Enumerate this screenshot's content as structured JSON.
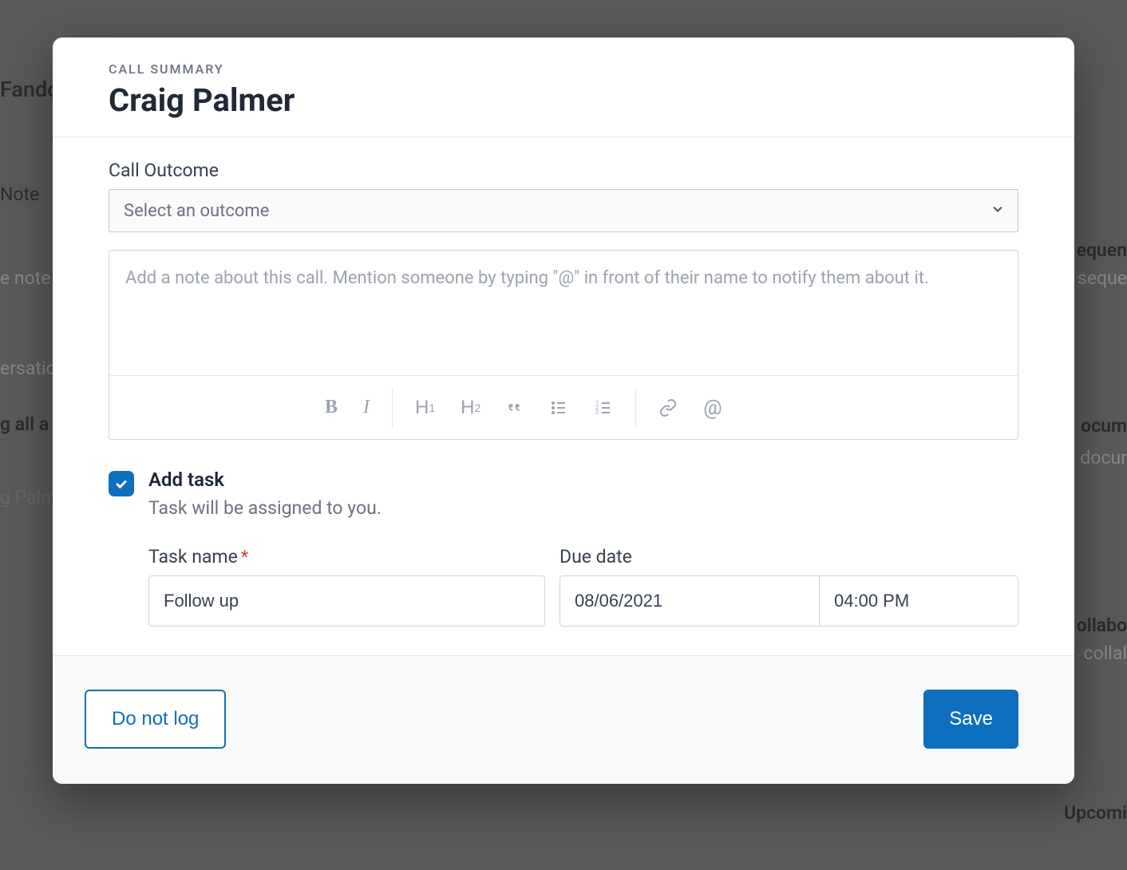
{
  "modal": {
    "eyebrow": "CALL SUMMARY",
    "title": "Craig Palmer",
    "outcome": {
      "label": "Call Outcome",
      "placeholder": "Select an outcome"
    },
    "note": {
      "placeholder": "Add a note about this call. Mention someone by typing \"@\" in front of their name to notify them about it."
    },
    "task": {
      "checkbox_checked": true,
      "title": "Add task",
      "subtitle": "Task will be assigned to you.",
      "name_label": "Task name",
      "name_value": "Follow up",
      "due_label": "Due date",
      "due_date": "08/06/2021",
      "due_time": "04:00 PM"
    },
    "footer": {
      "do_not_log": "Do not log",
      "save": "Save"
    }
  },
  "background": {
    "t1": "Fando",
    "t2": "Note",
    "t3": "e note",
    "t4": "ersatio",
    "t5": "g all a",
    "t6": "g Palme",
    "t7": "equen",
    "t8": "seque",
    "t9": "ocum",
    "t10": "docur",
    "t11": "ollabo",
    "t12": "collal",
    "t13": "Upcomi"
  }
}
